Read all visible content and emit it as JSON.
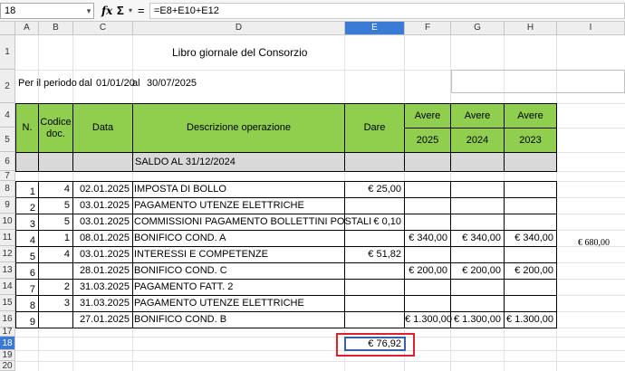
{
  "formula_bar": {
    "name_box": "18",
    "fx_label": "fx",
    "sigma_label": "Σ",
    "equals_label": "=",
    "formula": "=E8+E10+E12"
  },
  "columns": [
    "A",
    "B",
    "C",
    "D",
    "E",
    "F",
    "G",
    "H",
    "I"
  ],
  "rows": [
    "1",
    "2",
    "4",
    "5",
    "6",
    "7",
    "8",
    "9",
    "10",
    "11",
    "12",
    "13",
    "14",
    "15",
    "16",
    "17",
    "18",
    "19",
    "20"
  ],
  "title": "Libro giornale del Consorzio",
  "period": {
    "label": "Per il periodo",
    "dal": "dal",
    "from": "01/01/20",
    "al": "al",
    "to": "30/07/2025"
  },
  "headers": {
    "n": "N.",
    "codice": "Codice doc.",
    "data": "Data",
    "descrizione": "Descrizione operazione",
    "dare": "Dare",
    "avere": "Avere",
    "y2025": "2025",
    "y2024": "2024",
    "y2023": "2023"
  },
  "saldo": "SALDO AL 31/12/2024",
  "entries": [
    {
      "n": "1",
      "cod": "4",
      "data": "02.01.2025",
      "desc": "IMPOSTA DI BOLLO",
      "dare": "€ 25,00",
      "a2025": "",
      "a2024": "",
      "a2023": ""
    },
    {
      "n": "2",
      "cod": "5",
      "data": "03.01.2025",
      "desc": "PAGAMENTO UTENZE ELETTRICHE",
      "dare": "",
      "a2025": "",
      "a2024": "",
      "a2023": ""
    },
    {
      "n": "3",
      "cod": "5",
      "data": "03.01.2025",
      "desc": "COMMISSIONI PAGAMENTO BOLLETTINI POSTALI",
      "dare": "€ 0,10",
      "a2025": "",
      "a2024": "",
      "a2023": ""
    },
    {
      "n": "4",
      "cod": "1",
      "data": "08.01.2025",
      "desc": "BONIFICO COND. A",
      "dare": "",
      "a2025": "€ 340,00",
      "a2024": "€ 340,00",
      "a2023": "€ 340,00"
    },
    {
      "n": "5",
      "cod": "4",
      "data": "03.01.2025",
      "desc": "INTERESSI E COMPETENZE",
      "dare": "€ 51,82",
      "a2025": "",
      "a2024": "",
      "a2023": ""
    },
    {
      "n": "6",
      "cod": "",
      "data": "28.01.2025",
      "desc": "BONIFICO COND. C",
      "dare": "",
      "a2025": "€ 200,00",
      "a2024": "€ 200,00",
      "a2023": "€ 200,00"
    },
    {
      "n": "7",
      "cod": "2",
      "data": "31.03.2025",
      "desc": "PAGAMENTO FATT. 2",
      "dare": "",
      "a2025": "",
      "a2024": "",
      "a2023": ""
    },
    {
      "n": "8",
      "cod": "3",
      "data": "31.03.2025",
      "desc": "PAGAMENTO UTENZE ELETTRICHE",
      "dare": "",
      "a2025": "",
      "a2024": "",
      "a2023": ""
    },
    {
      "n": "9",
      "cod": "",
      "data": "27.01.2025",
      "desc": "BONIFICO COND. B",
      "dare": "",
      "a2025": "€ 1.300,00",
      "a2024": "€ 1.300,00",
      "a2023": "€ 1.300,00"
    }
  ],
  "i11": "€ 680,00",
  "e18": "€ 76,92"
}
